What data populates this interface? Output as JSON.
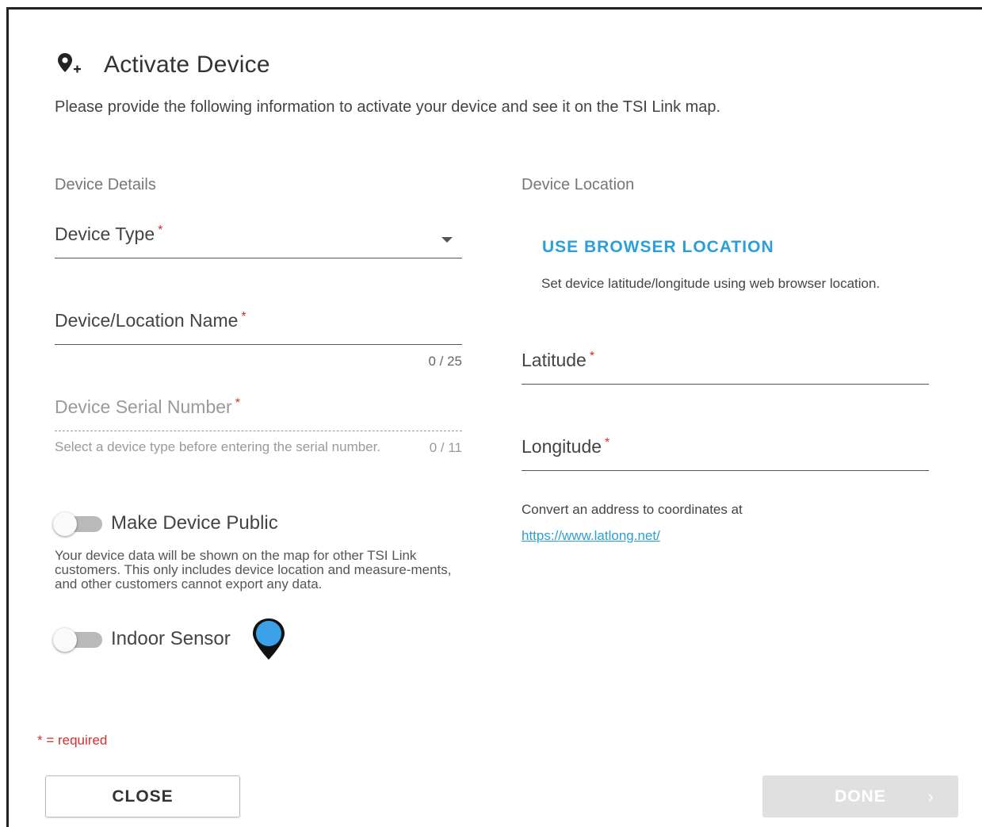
{
  "dialog": {
    "title": "Activate Device",
    "subtitle": "Please provide the following information to activate your device and see it on the TSI Link map.",
    "title_icon": "add-location-icon"
  },
  "device_details": {
    "section_label": "Device Details",
    "device_type": {
      "label": "Device Type",
      "required_mark": "*",
      "value": ""
    },
    "location_name": {
      "label": "Device/Location Name",
      "required_mark": "*",
      "value": "",
      "counter": "0 / 25"
    },
    "serial_number": {
      "label": "Device Serial Number",
      "required_mark": "*",
      "value": "",
      "hint": "Select a device type before entering the serial number.",
      "counter": "0 / 11"
    },
    "make_public": {
      "label": "Make Device Public",
      "checked": false,
      "description": "Your device data will be shown on the map for other TSI Link customers. This only includes device location and measure-ments, and other customers cannot export any data."
    },
    "indoor_sensor": {
      "label": "Indoor Sensor",
      "checked": false,
      "marker_icon": "map-pin-icon",
      "marker_color": "#3aa0e8"
    }
  },
  "device_location": {
    "section_label": "Device Location",
    "browser_location_button": "USE BROWSER LOCATION",
    "browser_location_note": "Set device latitude/longitude using web browser location.",
    "latitude": {
      "label": "Latitude",
      "required_mark": "*",
      "value": ""
    },
    "longitude": {
      "label": "Longitude",
      "required_mark": "*",
      "value": ""
    },
    "convert_note": "Convert an address to coordinates at",
    "convert_link": "https://www.latlong.net/"
  },
  "footer": {
    "required_note": "* = required",
    "close_label": "CLOSE",
    "done_label": "DONE",
    "done_chevron": "›"
  },
  "colors": {
    "accent": "#2a9fd8",
    "required": "#d32f2f",
    "disabled_button": "#e0e0e0"
  }
}
